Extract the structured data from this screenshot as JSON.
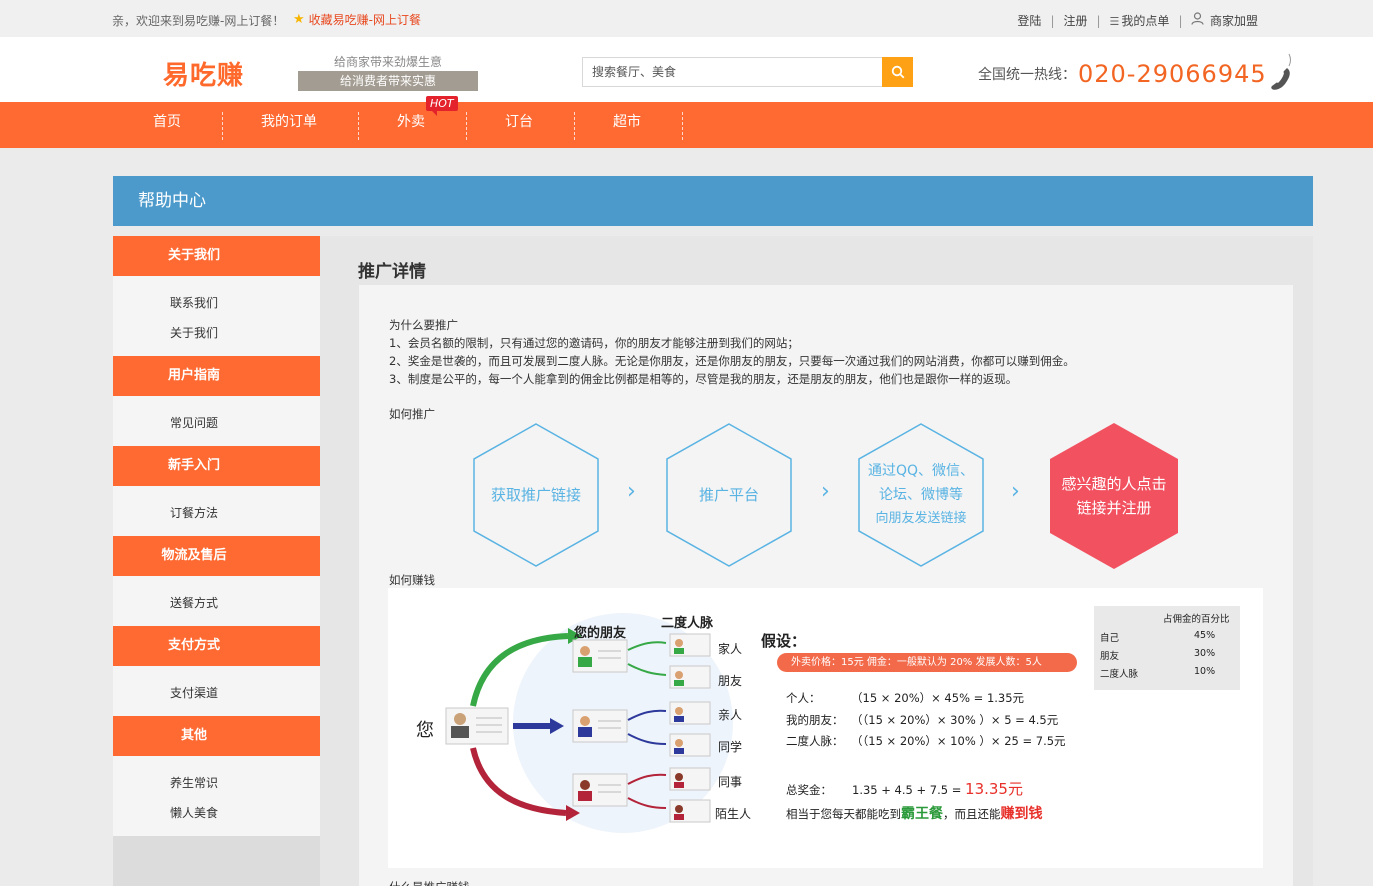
{
  "topbar": {
    "welcome": "亲，欢迎来到易吃赚-网上订餐！",
    "favorite": "收藏易吃赚-网上订餐",
    "login": "登陆",
    "register": "注册",
    "my_orders": "我的点单",
    "merchant_join": "商家加盟"
  },
  "header": {
    "logo": "易吃赚",
    "slogan_merchant": "给商家带来劲爆生意",
    "slogan_consumer": "给消费者带来实惠",
    "search_placeholder": "搜索餐厅、美食",
    "hotline_label": "全国统一热线：",
    "hotline_number": "020-29066945"
  },
  "nav": {
    "items": [
      "首页",
      "我的订单",
      "外卖",
      "订台",
      "超市"
    ],
    "hot_badge": "HOT"
  },
  "help_center": {
    "title": "帮助中心"
  },
  "sidebar": {
    "sections": [
      {
        "title": "关于我们",
        "links": [
          "联系我们",
          "关于我们"
        ]
      },
      {
        "title": "用户指南",
        "links": [
          "常见问题"
        ]
      },
      {
        "title": "新手入门",
        "links": [
          "订餐方法"
        ]
      },
      {
        "title": "物流及售后",
        "links": [
          "送餐方式"
        ]
      },
      {
        "title": "支付方式",
        "links": [
          "支付渠道"
        ]
      },
      {
        "title": "其他",
        "links": [
          "养生常识",
          "懒人美食"
        ]
      }
    ]
  },
  "main": {
    "title": "推广详情",
    "why_title": "为什么要推广",
    "why_points": [
      "1、会员名额的限制，只有通过您的邀请码，你的朋友才能够注册到我们的网站；",
      "2、奖金是世袭的，而且可发展到二度人脉。无论是你朋友，还是你朋友的朋友，只要每一次通过我们的网站消费，你都可以赚到佣金。",
      "3、制度是公平的，每一个人能拿到的佣金比例都是相等的，尽管是我的朋友，还是朋友的朋友，他们也是跟你一样的返现。"
    ],
    "how_promote_title": "如何推广",
    "steps": [
      {
        "line1": "获取推广链接"
      },
      {
        "line1": "推广平台"
      },
      {
        "line1": "通过QQ、微信、",
        "line2": "论坛、微博等",
        "line3": "向朋友发送链接"
      },
      {
        "line1": "感兴趣的人点击",
        "line2": "链接并注册"
      }
    ],
    "how_earn_title": "如何赚钱",
    "diagram": {
      "you": "您",
      "friends_label": "您的朋友",
      "second_degree_label": "二度人脉",
      "relations": [
        "家人",
        "朋友",
        "亲人",
        "同学",
        "同事",
        "陌生人"
      ],
      "assume_title": "假设：",
      "assume_pill": "外卖价格：15元   佣金：一般默认为 20%   发展人数：5人",
      "calc_rows": [
        {
          "label": "个人：",
          "formula": "（15 × 20%）× 45% = 1.35元"
        },
        {
          "label": "我的朋友：",
          "formula": "（（15 × 20%）× 30% ）× 5 = 4.5元"
        },
        {
          "label": "二度人脉：",
          "formula": "（（15 × 20%）× 10% ）× 25 = 7.5元"
        }
      ],
      "total_label": "总奖金：",
      "total_formula": "1.35 + 4.5 + 7.5 = ",
      "total_value": "13.35元",
      "summary_prefix": "相当于您每天都能吃到",
      "summary_meal": "霸王餐",
      "summary_mid": "，而且还能",
      "summary_earn": "赚到钱",
      "pct_header": "占佣金的百分比",
      "pct_rows": [
        {
          "who": "自己",
          "pct": "45%"
        },
        {
          "who": "朋友",
          "pct": "30%"
        },
        {
          "who": "二度人脉",
          "pct": "10%"
        }
      ]
    },
    "bottom_cut_text": "什么是推广赚钱"
  },
  "colors": {
    "orange": "#ff6a32",
    "blue": "#4b9acb",
    "hex_blue": "#59b3e3",
    "hex_red": "#f25160"
  }
}
